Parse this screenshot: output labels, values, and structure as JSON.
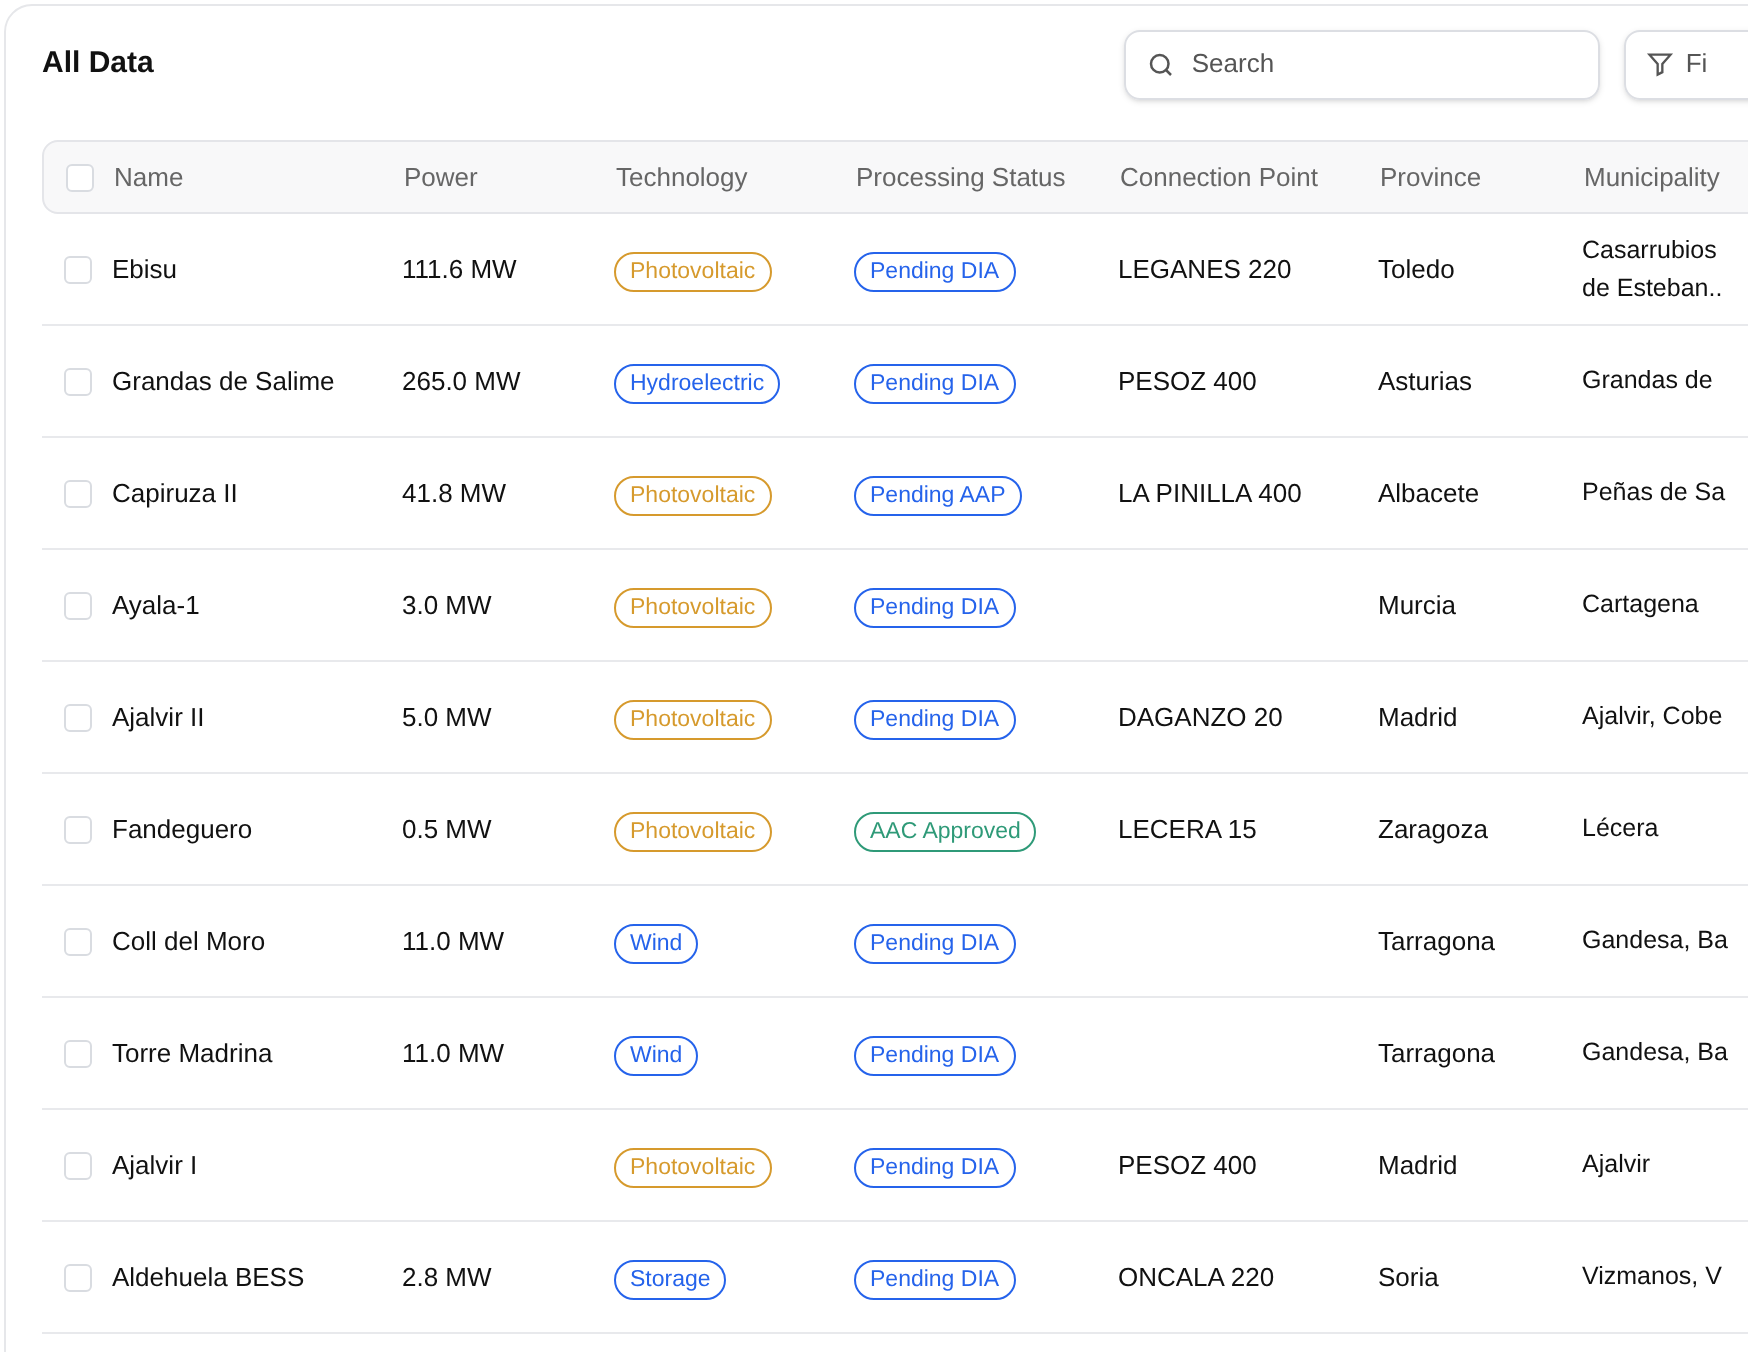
{
  "title": "All Data",
  "search": {
    "placeholder": "Search"
  },
  "filter_button": {
    "label": "Fi"
  },
  "table": {
    "select_all": {
      "checked": false
    },
    "columns": [
      "Name",
      "Power",
      "Technology",
      "Processing Status",
      "Connection Point",
      "Province",
      "Municipality"
    ],
    "rows": [
      {
        "checked": false,
        "name": "Ebisu",
        "power": "111.6 MW",
        "technology": {
          "label": "Photovoltaic",
          "color": "#d69a2d"
        },
        "status": {
          "label": "Pending DIA",
          "color": "#2563eb"
        },
        "connection_point": "LEGANES 220",
        "province": "Toledo",
        "municipality": "Casarrubios de Esteban.."
      },
      {
        "checked": false,
        "name": "Grandas de Salime",
        "power": "265.0 MW",
        "technology": {
          "label": "Hydroelectric",
          "color": "#2563eb"
        },
        "status": {
          "label": "Pending DIA",
          "color": "#2563eb"
        },
        "connection_point": "PESOZ 400",
        "province": "Asturias",
        "municipality": "Grandas de"
      },
      {
        "checked": false,
        "name": "Capiruza II",
        "power": "41.8 MW",
        "technology": {
          "label": "Photovoltaic",
          "color": "#d69a2d"
        },
        "status": {
          "label": "Pending AAP",
          "color": "#2563eb"
        },
        "connection_point": "LA PINILLA 400",
        "province": "Albacete",
        "municipality": "Peñas de Sa"
      },
      {
        "checked": false,
        "name": "Ayala-1",
        "power": "3.0 MW",
        "technology": {
          "label": "Photovoltaic",
          "color": "#d69a2d"
        },
        "status": {
          "label": "Pending DIA",
          "color": "#2563eb"
        },
        "connection_point": "",
        "province": "Murcia",
        "municipality": "Cartagena"
      },
      {
        "checked": false,
        "name": "Ajalvir II",
        "power": "5.0 MW",
        "technology": {
          "label": "Photovoltaic",
          "color": "#d69a2d"
        },
        "status": {
          "label": "Pending DIA",
          "color": "#2563eb"
        },
        "connection_point": "DAGANZO 20",
        "province": "Madrid",
        "municipality": "Ajalvir, Cobe"
      },
      {
        "checked": false,
        "name": "Fandeguero",
        "power": "0.5 MW",
        "technology": {
          "label": "Photovoltaic",
          "color": "#d69a2d"
        },
        "status": {
          "label": "AAC Approved",
          "color": "#2f9a78"
        },
        "connection_point": "LECERA 15",
        "province": "Zaragoza",
        "municipality": "Lécera"
      },
      {
        "checked": false,
        "name": "Coll del Moro",
        "power": "11.0 MW",
        "technology": {
          "label": "Wind",
          "color": "#2563eb"
        },
        "status": {
          "label": "Pending DIA",
          "color": "#2563eb"
        },
        "connection_point": "",
        "province": "Tarragona",
        "municipality": "Gandesa, Ba"
      },
      {
        "checked": false,
        "name": "Torre Madrina",
        "power": "11.0 MW",
        "technology": {
          "label": "Wind",
          "color": "#2563eb"
        },
        "status": {
          "label": "Pending DIA",
          "color": "#2563eb"
        },
        "connection_point": "",
        "province": "Tarragona",
        "municipality": "Gandesa, Ba"
      },
      {
        "checked": false,
        "name": "Ajalvir I",
        "power": "",
        "technology": {
          "label": "Photovoltaic",
          "color": "#d69a2d"
        },
        "status": {
          "label": "Pending DIA",
          "color": "#2563eb"
        },
        "connection_point": "PESOZ 400",
        "province": "Madrid",
        "municipality": "Ajalvir"
      },
      {
        "checked": false,
        "name": "Aldehuela BESS",
        "power": "2.8 MW",
        "technology": {
          "label": "Storage",
          "color": "#2563eb"
        },
        "status": {
          "label": "Pending DIA",
          "color": "#2563eb"
        },
        "connection_point": "ONCALA 220",
        "province": "Soria",
        "municipality": "Vizmanos, V"
      }
    ]
  }
}
